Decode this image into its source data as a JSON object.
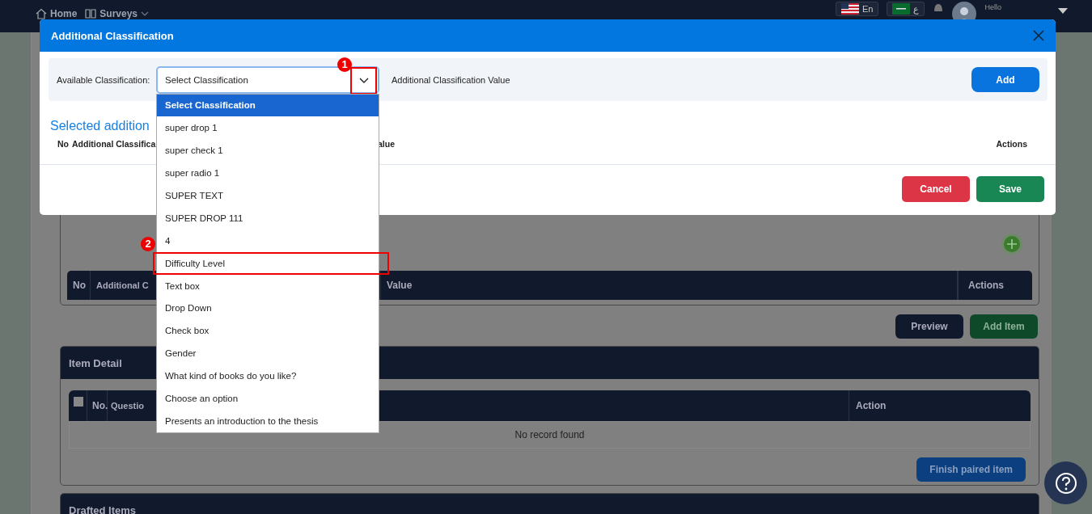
{
  "topbar": {
    "nav": [
      {
        "label": "Home",
        "kind": "home"
      },
      {
        "label": "Surveys",
        "kind": "menu"
      }
    ],
    "languages": [
      {
        "label": "En",
        "kind": "us"
      },
      {
        "label": "ع",
        "kind": "sa"
      }
    ],
    "greeting": "Hello"
  },
  "page": {
    "classification_table": {
      "columns": [
        "No",
        "Additional C",
        "Value",
        "Actions"
      ]
    },
    "actions": [
      {
        "label": "Preview",
        "kind": "dark"
      },
      {
        "label": "Add Item",
        "kind": "green"
      }
    ],
    "item_detail": {
      "title": "Item Detail",
      "select_all_checked": false,
      "columns": [
        "No.",
        "Questio",
        "Action"
      ],
      "empty": "No record found",
      "finish": "Finish paired item"
    },
    "drafted_items": {
      "title": "Drafted Items"
    }
  },
  "modal": {
    "title": "Additional Classification",
    "filter": {
      "label": "Available Classification:",
      "select": {
        "value": "Select Classification",
        "marker": "1",
        "highlighted": true
      },
      "value_label": "Additional Classification Value",
      "add": "Add"
    },
    "heading": "Selected addition",
    "columns": [
      "No",
      "Additional Classifica",
      "alue",
      "Actions"
    ],
    "buttons": [
      {
        "label": "Cancel",
        "kind": "danger"
      },
      {
        "label": "Save",
        "kind": "success"
      }
    ]
  },
  "dropdown": {
    "options": [
      {
        "label": "Select Classification",
        "selected": true,
        "highlighted": false
      },
      {
        "label": "super drop 1",
        "selected": false,
        "highlighted": false
      },
      {
        "label": "super check 1",
        "selected": false,
        "highlighted": false
      },
      {
        "label": "super radio 1",
        "selected": false,
        "highlighted": false
      },
      {
        "label": "SUPER TEXT",
        "selected": false,
        "highlighted": false
      },
      {
        "label": "SUPER DROP 111",
        "selected": false,
        "highlighted": false
      },
      {
        "label": "4",
        "selected": false,
        "highlighted": false
      },
      {
        "label": "Difficulty Level",
        "selected": false,
        "highlighted": true,
        "marker": "2"
      },
      {
        "label": "Text box",
        "selected": false,
        "highlighted": false
      },
      {
        "label": "Drop Down",
        "selected": false,
        "highlighted": false
      },
      {
        "label": "Check box",
        "selected": false,
        "highlighted": false
      },
      {
        "label": "Gender",
        "selected": false,
        "highlighted": false
      },
      {
        "label": "What kind of books do you like?",
        "selected": false,
        "highlighted": false
      },
      {
        "label": "Choose an option",
        "selected": false,
        "highlighted": false
      },
      {
        "label": "Presents an introduction to the thesis",
        "selected": false,
        "highlighted": false
      }
    ]
  }
}
